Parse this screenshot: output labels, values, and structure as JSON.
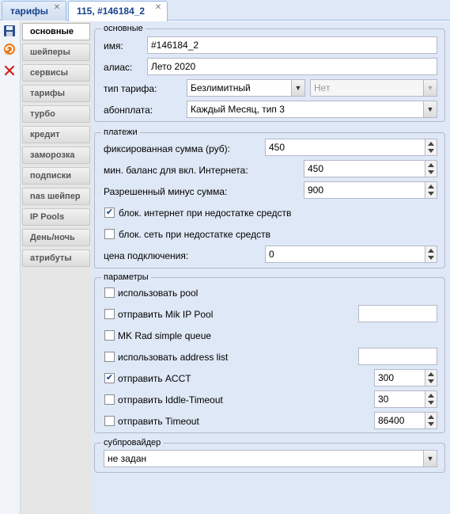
{
  "tabs": [
    {
      "label": "тарифы",
      "active": false
    },
    {
      "label": "115, #146184_2",
      "active": true
    }
  ],
  "toolbar_icons": [
    "save-icon",
    "refresh-icon",
    "delete-icon"
  ],
  "nav": {
    "items": [
      "основные",
      "шейперы",
      "сервисы",
      "тарифы",
      "турбо",
      "кредит",
      "заморозка",
      "подписки",
      "nas шейпер",
      "IP Pools",
      "День/ночь",
      "атрибуты"
    ],
    "active_index": 0
  },
  "basic": {
    "legend": "основные",
    "name_label": "имя:",
    "name_value": "#146184_2",
    "alias_label": "алиас:",
    "alias_value": "Лето 2020",
    "type_label": "тип тарифа:",
    "type_value": "Безлимитный",
    "type_extra_value": "Нет",
    "fee_label": "абонплата:",
    "fee_value": "Каждый Месяц, тип 3"
  },
  "payments": {
    "legend": "платежи",
    "fixed_label": "фиксированная сумма (руб):",
    "fixed_value": "450",
    "min_balance_label": "мин. баланс для вкл. Интернета:",
    "min_balance_value": "450",
    "allowed_minus_label": "Разрешенный минус сумма:",
    "allowed_minus_value": "900",
    "block_internet_label": "блок. интернет при недостатке средств",
    "block_internet_checked": true,
    "block_network_label": "блок. сеть при недостатке средств",
    "block_network_checked": false,
    "connection_price_label": "цена подключения:",
    "connection_price_value": "0"
  },
  "params": {
    "legend": "параметры",
    "use_pool_label": "использовать pool",
    "send_mik_pool_label": "отправить Mik IP Pool",
    "mk_rad_label": "MK Rad simple queue",
    "use_address_list_label": "использовать address list",
    "send_acct_label": "отправить ACCT",
    "send_acct_value": "300",
    "send_idle_label": "отправить Iddle-Timeout",
    "send_idle_value": "30",
    "send_timeout_label": "отправить Timeout",
    "send_timeout_value": "86400"
  },
  "subprovider": {
    "legend": "субпровайдер",
    "value": "не задан"
  }
}
